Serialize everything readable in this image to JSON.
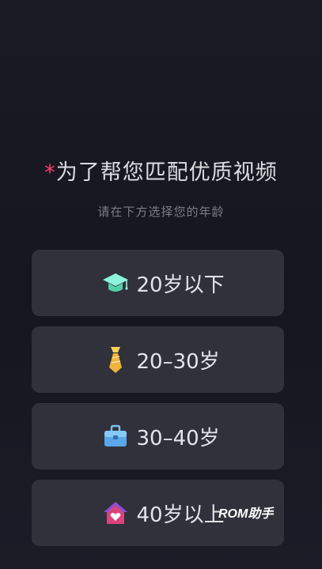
{
  "header": {
    "required_mark": "*",
    "title": "为了帮您匹配优质视频",
    "subtitle": "请在下方选择您的年龄"
  },
  "age_options": [
    {
      "label": "20岁以下",
      "icon": "graduation-cap-icon",
      "icon_color": "#6fe6c8"
    },
    {
      "label": "20–30岁",
      "icon": "necktie-icon",
      "icon_color": "#f5c24a"
    },
    {
      "label": "30–40岁",
      "icon": "briefcase-icon",
      "icon_color": "#5aa0e6"
    },
    {
      "label": "40岁以上",
      "icon": "house-heart-icon",
      "icon_color": "#e0457a"
    }
  ],
  "watermark": "ROM助手"
}
